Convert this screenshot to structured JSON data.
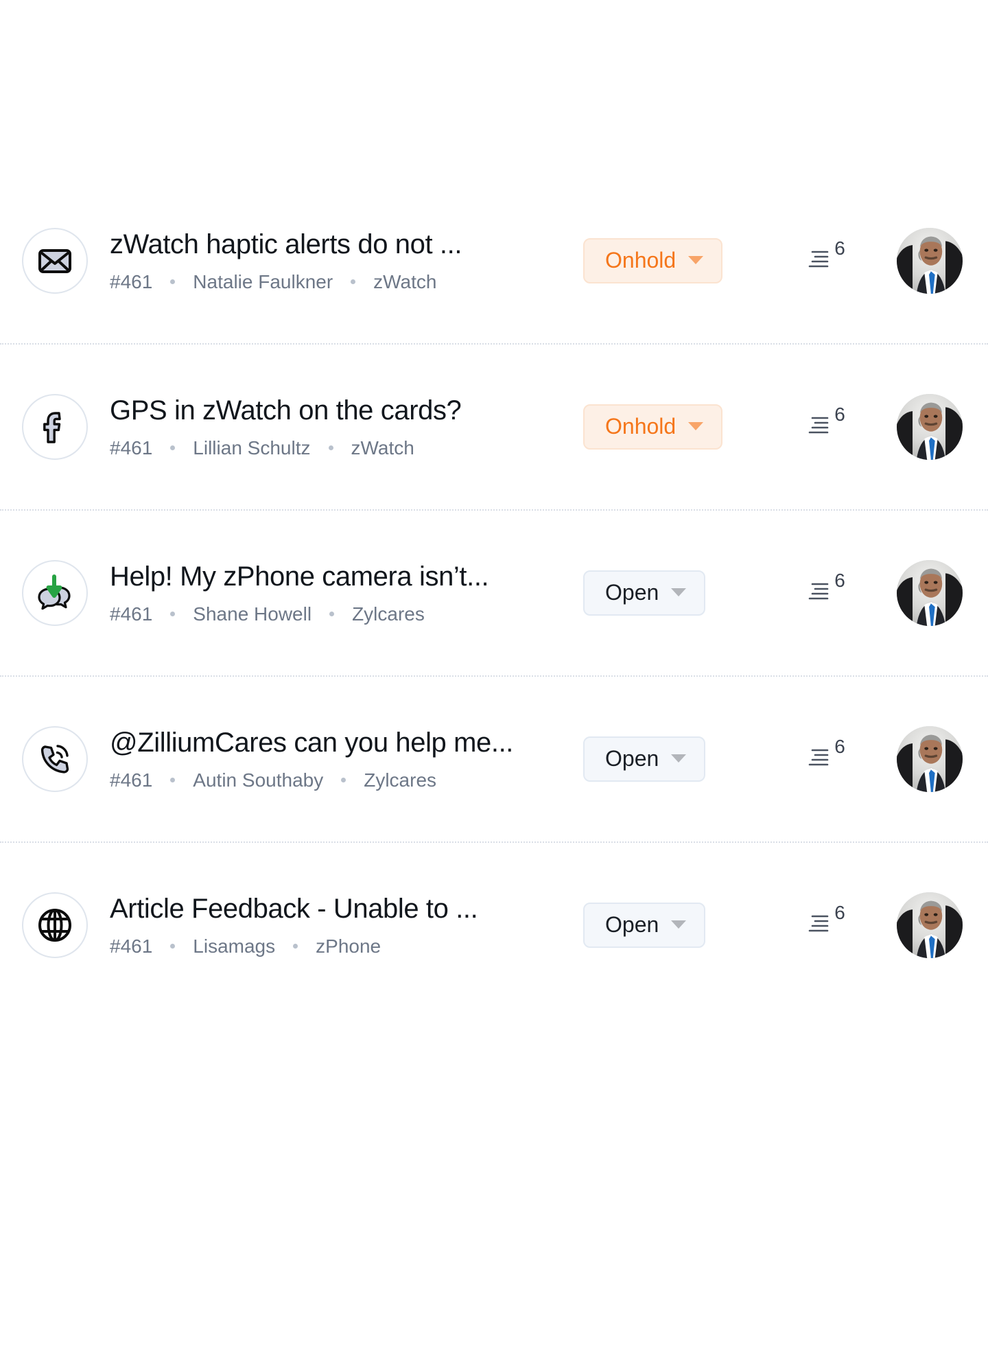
{
  "accent_colors": {
    "onhold_text": "#f5761a",
    "onhold_bg": "#fdf0e6",
    "open_text": "#1a1f26",
    "open_bg": "#f4f7fb",
    "divider": "#d9dee6",
    "meta_text": "#6d7787",
    "subject_text": "#11161c"
  },
  "tickets": [
    {
      "channel_icon": "envelope-icon",
      "subject": "zWatch haptic alerts do not ...",
      "ticket_number": "#461",
      "requester": "Natalie Faulkner",
      "product": "zWatch",
      "status": "Onhold",
      "status_kind": "onhold",
      "thread_count": "6",
      "avatar": "agent-avatar"
    },
    {
      "channel_icon": "facebook-icon",
      "subject": "GPS in zWatch on the cards?",
      "ticket_number": "#461",
      "requester": "Lillian Schultz",
      "product": "zWatch",
      "status": "Onhold",
      "status_kind": "onhold",
      "thread_count": "6",
      "avatar": "agent-avatar"
    },
    {
      "channel_icon": "chat-incoming-icon",
      "subject": "Help! My zPhone camera isn’t...",
      "ticket_number": "#461",
      "requester": "Shane Howell",
      "product": "Zylcares",
      "status": "Open",
      "status_kind": "open",
      "thread_count": "6",
      "avatar": "agent-avatar"
    },
    {
      "channel_icon": "phone-icon",
      "subject": "@ZilliumCares can you help me...",
      "ticket_number": "#461",
      "requester": "Autin Southaby",
      "product": "Zylcares",
      "status": "Open",
      "status_kind": "open",
      "thread_count": "6",
      "avatar": "agent-avatar"
    },
    {
      "channel_icon": "globe-icon",
      "subject": "Article Feedback - Unable to ...",
      "ticket_number": "#461",
      "requester": "Lisamags",
      "product": "zPhone",
      "status": "Open",
      "status_kind": "open",
      "thread_count": "6",
      "avatar": "agent-avatar"
    }
  ]
}
